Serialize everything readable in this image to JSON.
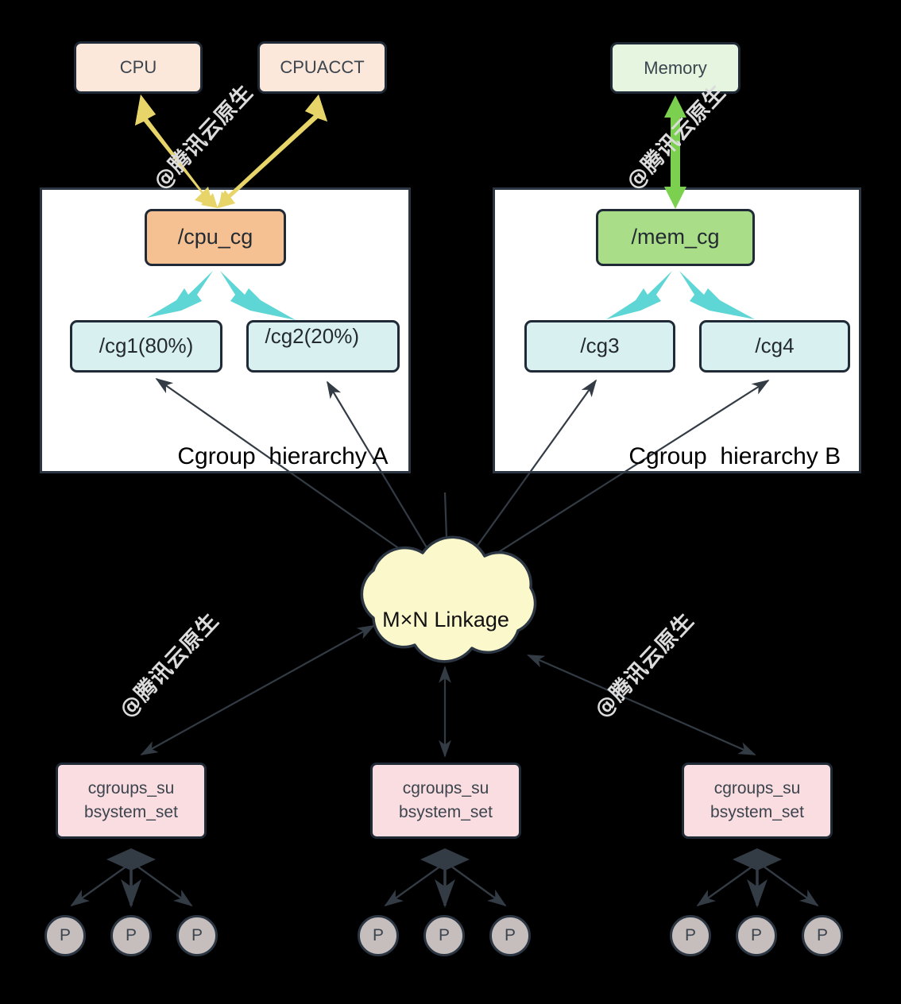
{
  "diagram": {
    "title": "Cgroups M x N linkage diagram",
    "colors": {
      "subsystem_cpu_fill": "#fbe8da",
      "subsystem_mem_fill": "#e6f5e0",
      "cpu_cg_fill": "#f5c193",
      "mem_cg_fill": "#a9dd88",
      "leaf_cg_fill": "#d8f0ef",
      "css_set_fill": "#fadde0",
      "cloud_fill": "#fbf8cc",
      "process_fill": "#c6bebd",
      "yellow_arrow": "#e8d56a",
      "green_arrow": "#7bd04f",
      "cyan_arrow": "#5ed6d6",
      "stroke": "#2b3642",
      "background": "#000000",
      "watermark": "#dcdcdc"
    }
  },
  "subsystems": [
    {
      "id": "cpu",
      "label": "CPU"
    },
    {
      "id": "cpuacct",
      "label": "CPUACCT"
    },
    {
      "id": "memory",
      "label": "Memory"
    }
  ],
  "hierarchies": [
    {
      "id": "a",
      "label": "Cgroup  hierarchy A",
      "root": {
        "id": "cpu_cg",
        "label": "/cpu_cg"
      },
      "children": [
        {
          "id": "cg1",
          "label": "/cg1(80%)"
        },
        {
          "id": "cg2",
          "label": "/cg2(20%)"
        }
      ]
    },
    {
      "id": "b",
      "label": "Cgroup  hierarchy B",
      "root": {
        "id": "mem_cg",
        "label": "/mem_cg"
      },
      "children": [
        {
          "id": "cg3",
          "label": "/cg3"
        },
        {
          "id": "cg4",
          "label": "/cg4"
        }
      ]
    }
  ],
  "cloud": {
    "label": "M×N Linkage"
  },
  "css_sets": [
    {
      "id": "set-left",
      "line1": "cgroups_su",
      "line2": "bsystem_set"
    },
    {
      "id": "set-mid",
      "line1": "cgroups_su",
      "line2": "bsystem_set"
    },
    {
      "id": "set-right",
      "line1": "cgroups_su",
      "line2": "bsystem_set"
    }
  ],
  "processes": {
    "label": "P",
    "groups": [
      {
        "set": "set-left",
        "count": 3
      },
      {
        "set": "set-mid",
        "count": 3
      },
      {
        "set": "set-right",
        "count": 3
      }
    ]
  },
  "watermarks": [
    {
      "id": "wm-top-left",
      "text": "@腾讯云原生"
    },
    {
      "id": "wm-top-right",
      "text": "@腾讯云原生"
    },
    {
      "id": "wm-bottom-left",
      "text": "@腾讯云原生"
    },
    {
      "id": "wm-bottom-right",
      "text": "@腾讯云原生"
    }
  ]
}
